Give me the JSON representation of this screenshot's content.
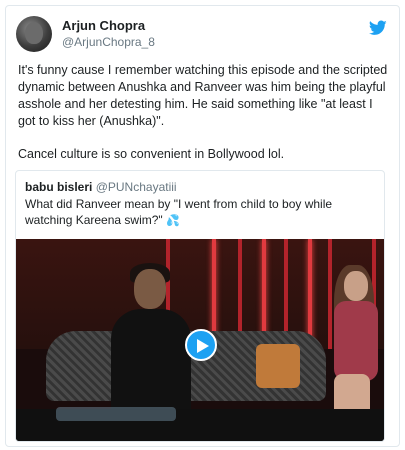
{
  "author": {
    "display_name": "Arjun Chopra",
    "handle": "@ArjunChopra_8",
    "avatar_icon": "avatar-icon"
  },
  "brand": {
    "icon": "twitter-bird-icon",
    "color": "#1da1f2"
  },
  "tweet": {
    "paragraph_1": "It's funny cause I remember watching this episode and the scripted dynamic between Anushka and Ranveer was him being the playful asshole and her detesting him. He said something like \"at least I got to kiss her (Anushka)\".",
    "paragraph_2": "Cancel culture is so convenient in Bollywood lol."
  },
  "quoted_tweet": {
    "display_name": "babu bisleri",
    "handle": "@PUNchayatiii",
    "text": "What did Ranveer mean by \"I went from child to boy while watching Kareena swim?\"",
    "emoji": "💦",
    "media": {
      "type": "video",
      "play_icon": "play-icon"
    }
  }
}
